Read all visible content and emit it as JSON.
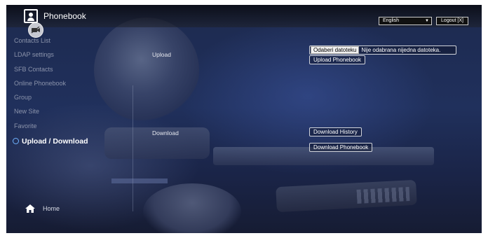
{
  "header": {
    "title": "Phonebook",
    "icons": {
      "app": "phonebook-icon",
      "camera": "camera-off-icon"
    },
    "language_select": {
      "value": "English"
    },
    "logout_label": "Logout [X]"
  },
  "sidebar": {
    "items": [
      {
        "label": "Contacts List",
        "active": false
      },
      {
        "label": "LDAP settings",
        "active": false
      },
      {
        "label": "SFB Contacts",
        "active": false
      },
      {
        "label": "Online Phonebook",
        "active": false
      },
      {
        "label": "Group",
        "active": false
      },
      {
        "label": "New Site",
        "active": false
      },
      {
        "label": "Favorite",
        "active": false
      },
      {
        "label": "Upload / Download",
        "active": true
      }
    ],
    "home_label": "Home",
    "home_icon": "home-icon"
  },
  "main": {
    "upload": {
      "label": "Upload",
      "file_button_label": "Odaberi datoteku",
      "file_status": "Nije odabrana nijedna datoteka.",
      "upload_button_label": "Upload Phonebook"
    },
    "download": {
      "label": "Download",
      "history_button_label": "Download History",
      "phonebook_button_label": "Download Phonebook"
    }
  },
  "colors": {
    "active_indicator": "#6fb2ff",
    "background": "#1d2a4f"
  }
}
